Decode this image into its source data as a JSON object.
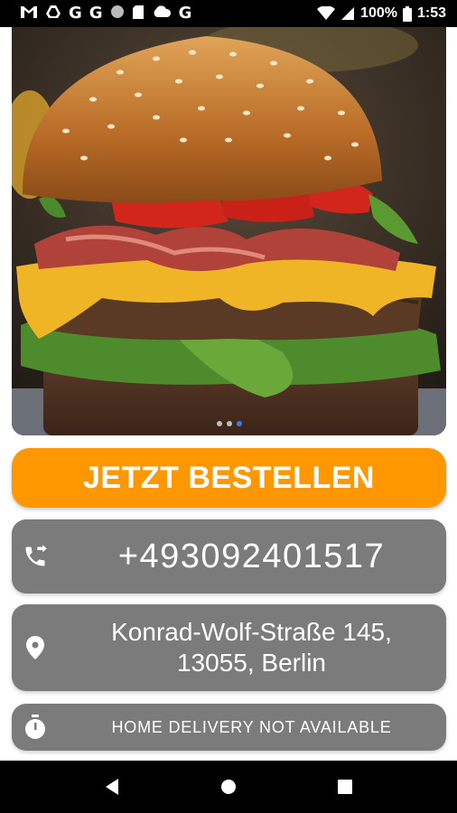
{
  "status_bar": {
    "battery": "100%",
    "time": "1:53",
    "notification_icons": [
      "gmail-icon",
      "drive-icon",
      "google-icon",
      "google-icon",
      "record-icon",
      "sd-card-icon",
      "cloud-icon",
      "google-icon"
    ]
  },
  "carousel": {
    "image": "burger-photo",
    "slide_count": 3,
    "active_index": 2
  },
  "order_button": {
    "label": "JETZT BESTELLEN",
    "color": "#ff9800"
  },
  "phone": {
    "number": "+493092401517",
    "icon": "phone-forward-icon"
  },
  "address": {
    "line1": "Konrad-Wolf-Straße 145,",
    "line2": "13055, Berlin",
    "icon": "location-pin-icon"
  },
  "delivery": {
    "status": "HOME DELIVERY NOT AVAILABLE",
    "icon": "stopwatch-icon"
  },
  "colors": {
    "card": "#7b7b7b",
    "accent": "#ff9800",
    "active_dot": "#2f80ed"
  }
}
